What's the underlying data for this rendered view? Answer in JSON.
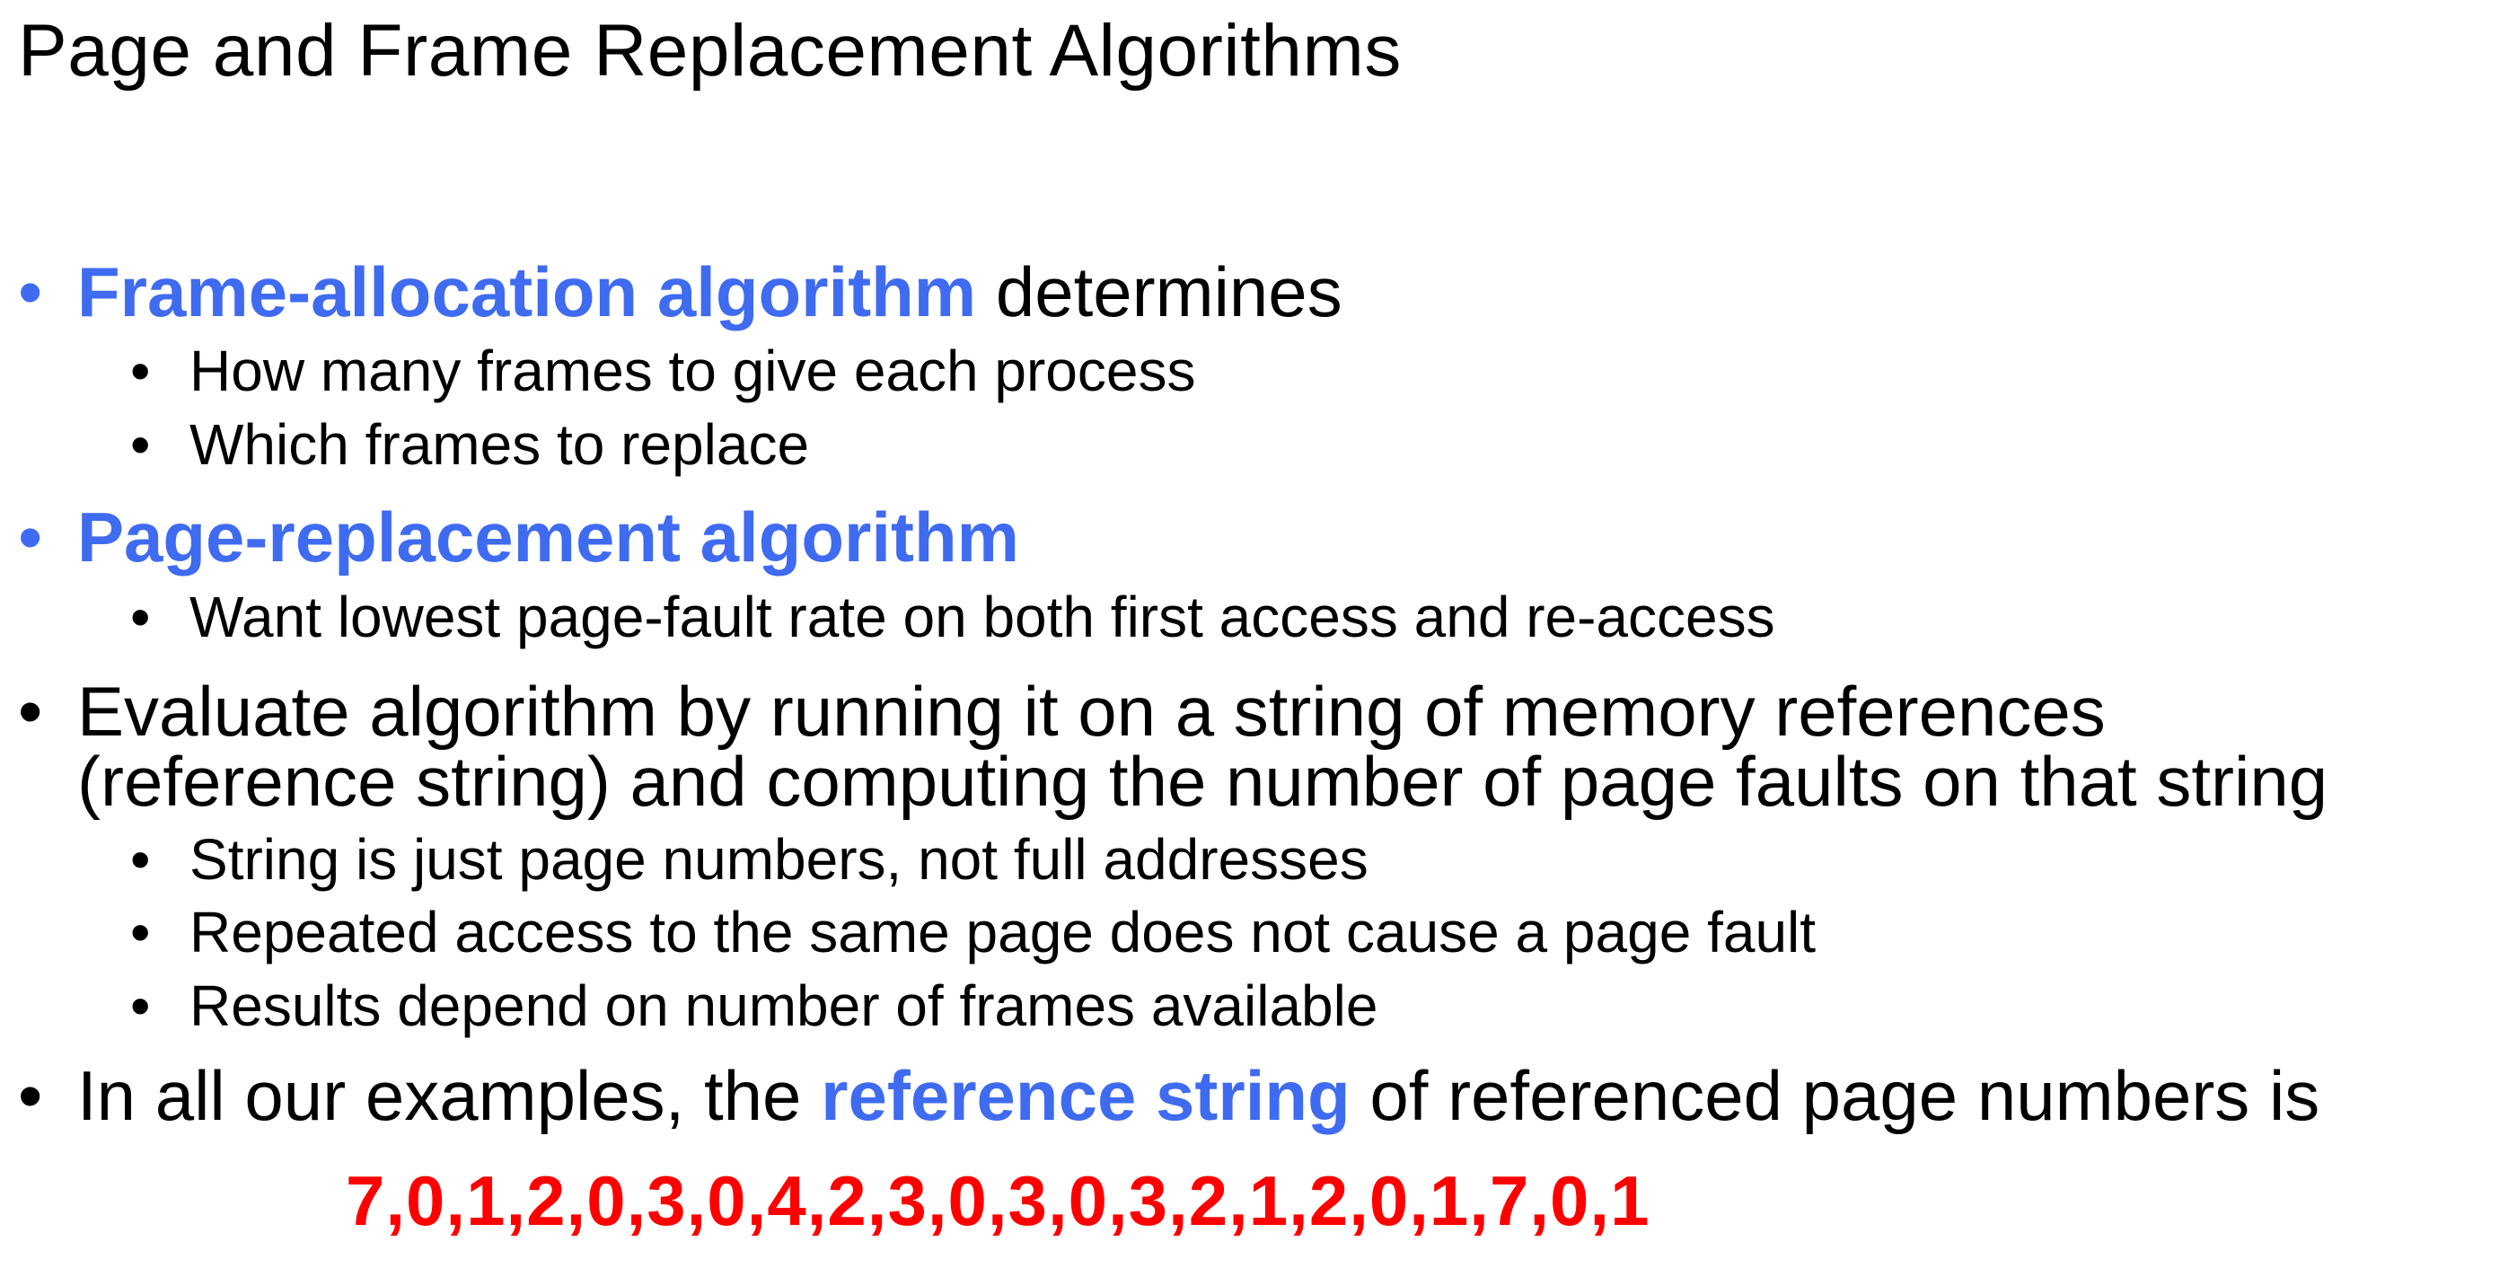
{
  "title": "Page and Frame Replacement Algorithms",
  "bullet_char": "•",
  "bullets": [
    {
      "highlight": "Frame-allocation algorithm",
      "text": " determines",
      "sub": [
        "How many frames to give each process",
        "Which frames to replace"
      ]
    },
    {
      "highlight": "Page-replacement algorithm",
      "text": "",
      "sub": [
        "Want lowest page-fault rate on both first access and re-access"
      ]
    },
    {
      "line1": "Evaluate algorithm by running it on a string of memory references",
      "line2": "(reference string) and computing the number of page faults on that string",
      "sub": [
        "String is just page numbers, not full addresses",
        "Repeated access to the same page does not cause a page fault",
        "Results depend on number of frames available"
      ]
    },
    {
      "prefix": "In all our examples, the ",
      "highlight": "reference string",
      "suffix": " of referenced page numbers is"
    }
  ],
  "reference_string": "7,0,1,2,0,3,0,4,2,3,0,3,0,3,2,1,2,0,1,7,0,1",
  "colors": {
    "accent_blue": "#3f6bf0",
    "sequence_red": "#ff0000",
    "text": "#000000",
    "background": "#ffffff"
  }
}
